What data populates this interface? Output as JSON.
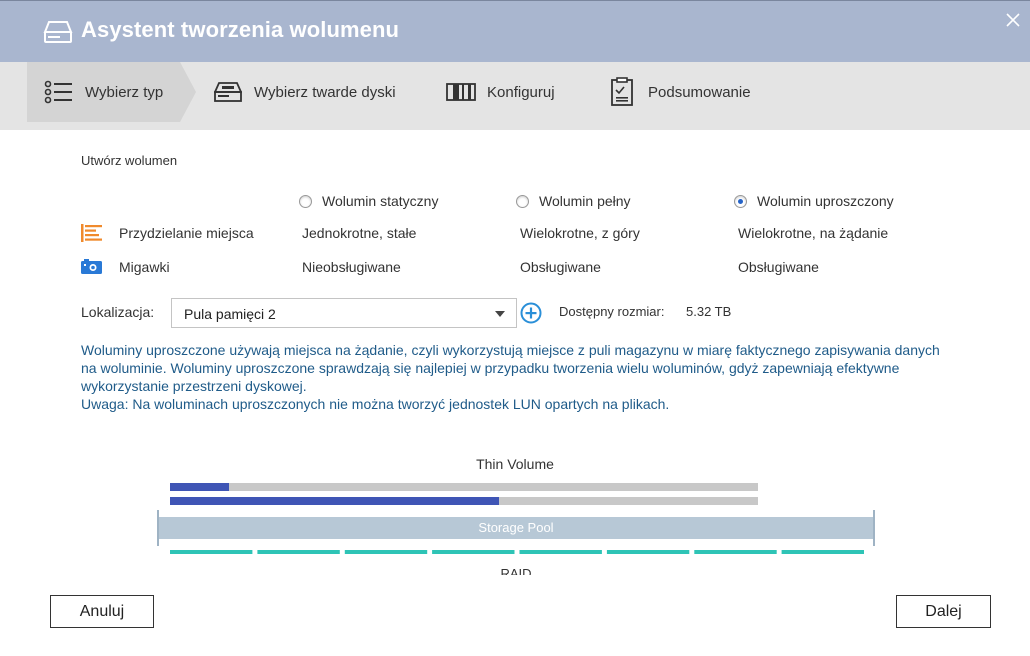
{
  "window": {
    "title": "Asystent tworzenia wolumenu",
    "close_icon": "close-icon",
    "header_color": "#a9b6cf"
  },
  "steps": [
    {
      "label": "Wybierz typ",
      "icon": "list-icon",
      "active": true
    },
    {
      "label": "Wybierz twarde dyski",
      "icon": "hard-drive-icon",
      "active": false
    },
    {
      "label": "Konfiguruj",
      "icon": "configure-icon",
      "active": false
    },
    {
      "label": "Podsumowanie",
      "icon": "clipboard-icon",
      "active": false
    }
  ],
  "section": {
    "title": "Utwórz wolumen"
  },
  "volume_types": [
    {
      "label": "Wolumin statyczny",
      "selected": false
    },
    {
      "label": "Wolumin pełny",
      "selected": false
    },
    {
      "label": "Wolumin uproszczony",
      "selected": true
    }
  ],
  "rows": [
    {
      "label": "Przydzielanie miejsca",
      "icon": "allocation-icon",
      "values": [
        "Jednokrotne, stałe",
        "Wielokrotne, z góry",
        "Wielokrotne, na żądanie"
      ]
    },
    {
      "label": "Migawki",
      "icon": "camera-icon",
      "values": [
        "Nieobsługiwane",
        "Obsługiwane",
        "Obsługiwane"
      ]
    }
  ],
  "location": {
    "label": "Lokalizacja:",
    "value": "Pula pamięci 2",
    "add_icon": "plus-circle-icon",
    "available_label": "Dostępny rozmiar:",
    "available_value": "5.32 TB"
  },
  "description": {
    "text": "Woluminy uproszczone używają miejsca na żądanie, czyli wykorzystują miejsce z puli magazynu w miarę faktycznego zapisywania danych na woluminie. Woluminy uproszczone sprawdzają się najlepiej w przypadku tworzenia wielu woluminów, gdyż zapewniają efektywne wykorzystanie przestrzeni dyskowej.",
    "note": "Uwaga: Na woluminach uproszczonych nie można tworzyć jednostek LUN opartych na plikach.",
    "color": "#1f5b89"
  },
  "diagram": {
    "title": "Thin Volume",
    "pool_label": "Storage Pool",
    "raid_label": "RAID",
    "bars": [
      {
        "fill": 0.1
      },
      {
        "fill": 0.56
      }
    ],
    "bar_color": "#3f55b5",
    "track_color": "#c8c8c8",
    "pool_color": "#b7c8d6",
    "raid_color": "#2ec4b6",
    "raid_segments": 8
  },
  "buttons": {
    "cancel": "Anuluj",
    "next": "Dalej"
  }
}
